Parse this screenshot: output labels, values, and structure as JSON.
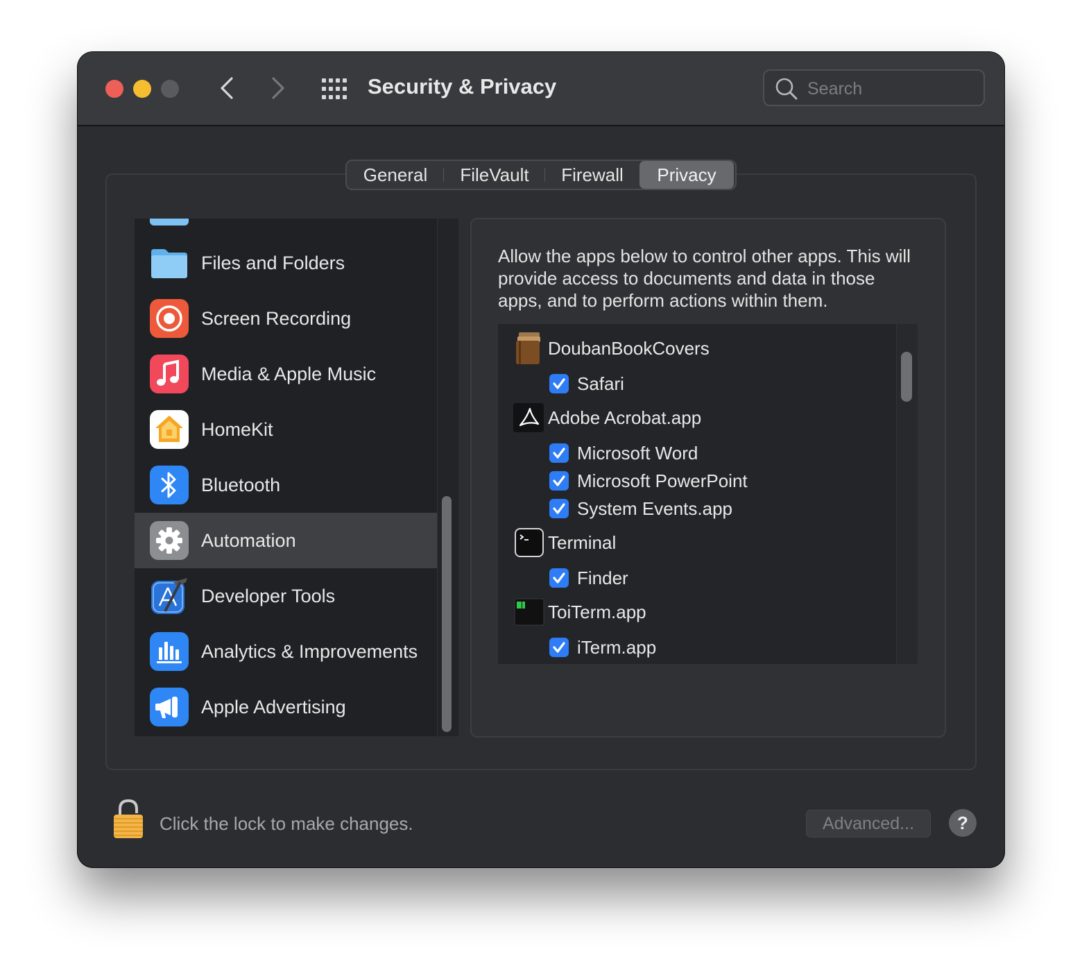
{
  "window": {
    "title": "Security & Privacy"
  },
  "toolbar": {
    "back_icon": "chevron-left-icon",
    "forward_icon": "chevron-right-icon",
    "show_all_icon": "grid-icon"
  },
  "search": {
    "placeholder": "Search",
    "value": ""
  },
  "tabs": [
    {
      "label": "General",
      "active": false
    },
    {
      "label": "FileVault",
      "active": false
    },
    {
      "label": "Firewall",
      "active": false
    },
    {
      "label": "Privacy",
      "active": true
    }
  ],
  "sidebar": {
    "items": [
      {
        "label": "Files and Folders",
        "icon": "folder-icon"
      },
      {
        "label": "Screen Recording",
        "icon": "screen-recording-icon"
      },
      {
        "label": "Media & Apple Music",
        "icon": "music-note-icon"
      },
      {
        "label": "HomeKit",
        "icon": "home-icon"
      },
      {
        "label": "Bluetooth",
        "icon": "bluetooth-icon"
      },
      {
        "label": "Automation",
        "icon": "gear-icon",
        "selected": true
      },
      {
        "label": "Developer Tools",
        "icon": "developer-tools-icon"
      },
      {
        "label": "Analytics & Improvements",
        "icon": "analytics-chart-icon"
      },
      {
        "label": "Apple Advertising",
        "icon": "megaphone-icon"
      }
    ]
  },
  "content": {
    "description": "Allow the apps below to control other apps. This will provide access to documents and data in those apps, and to perform actions within them.",
    "apps": [
      {
        "name": "DoubanBookCovers",
        "icon": "books-icon",
        "targets": [
          {
            "name": "Safari",
            "checked": true
          }
        ]
      },
      {
        "name": "Adobe Acrobat.app",
        "icon": "acrobat-icon",
        "targets": [
          {
            "name": "Microsoft Word",
            "checked": true
          },
          {
            "name": "Microsoft PowerPoint",
            "checked": true
          },
          {
            "name": "System Events.app",
            "checked": true
          }
        ]
      },
      {
        "name": "Terminal",
        "icon": "terminal-icon",
        "targets": [
          {
            "name": "Finder",
            "checked": true
          }
        ]
      },
      {
        "name": "ToiTerm.app",
        "icon": "toiterm-icon",
        "targets": [
          {
            "name": "iTerm.app",
            "checked": true
          }
        ]
      }
    ]
  },
  "footer": {
    "lock_text": "Click the lock to make changes.",
    "lock_icon": "lock-icon",
    "advanced_label": "Advanced...",
    "help_label": "?"
  },
  "colors": {
    "accent": "#2e7cf6",
    "window_bg": "#2b2d30",
    "close": "#ee5f57",
    "minimize": "#f5bd2f"
  }
}
